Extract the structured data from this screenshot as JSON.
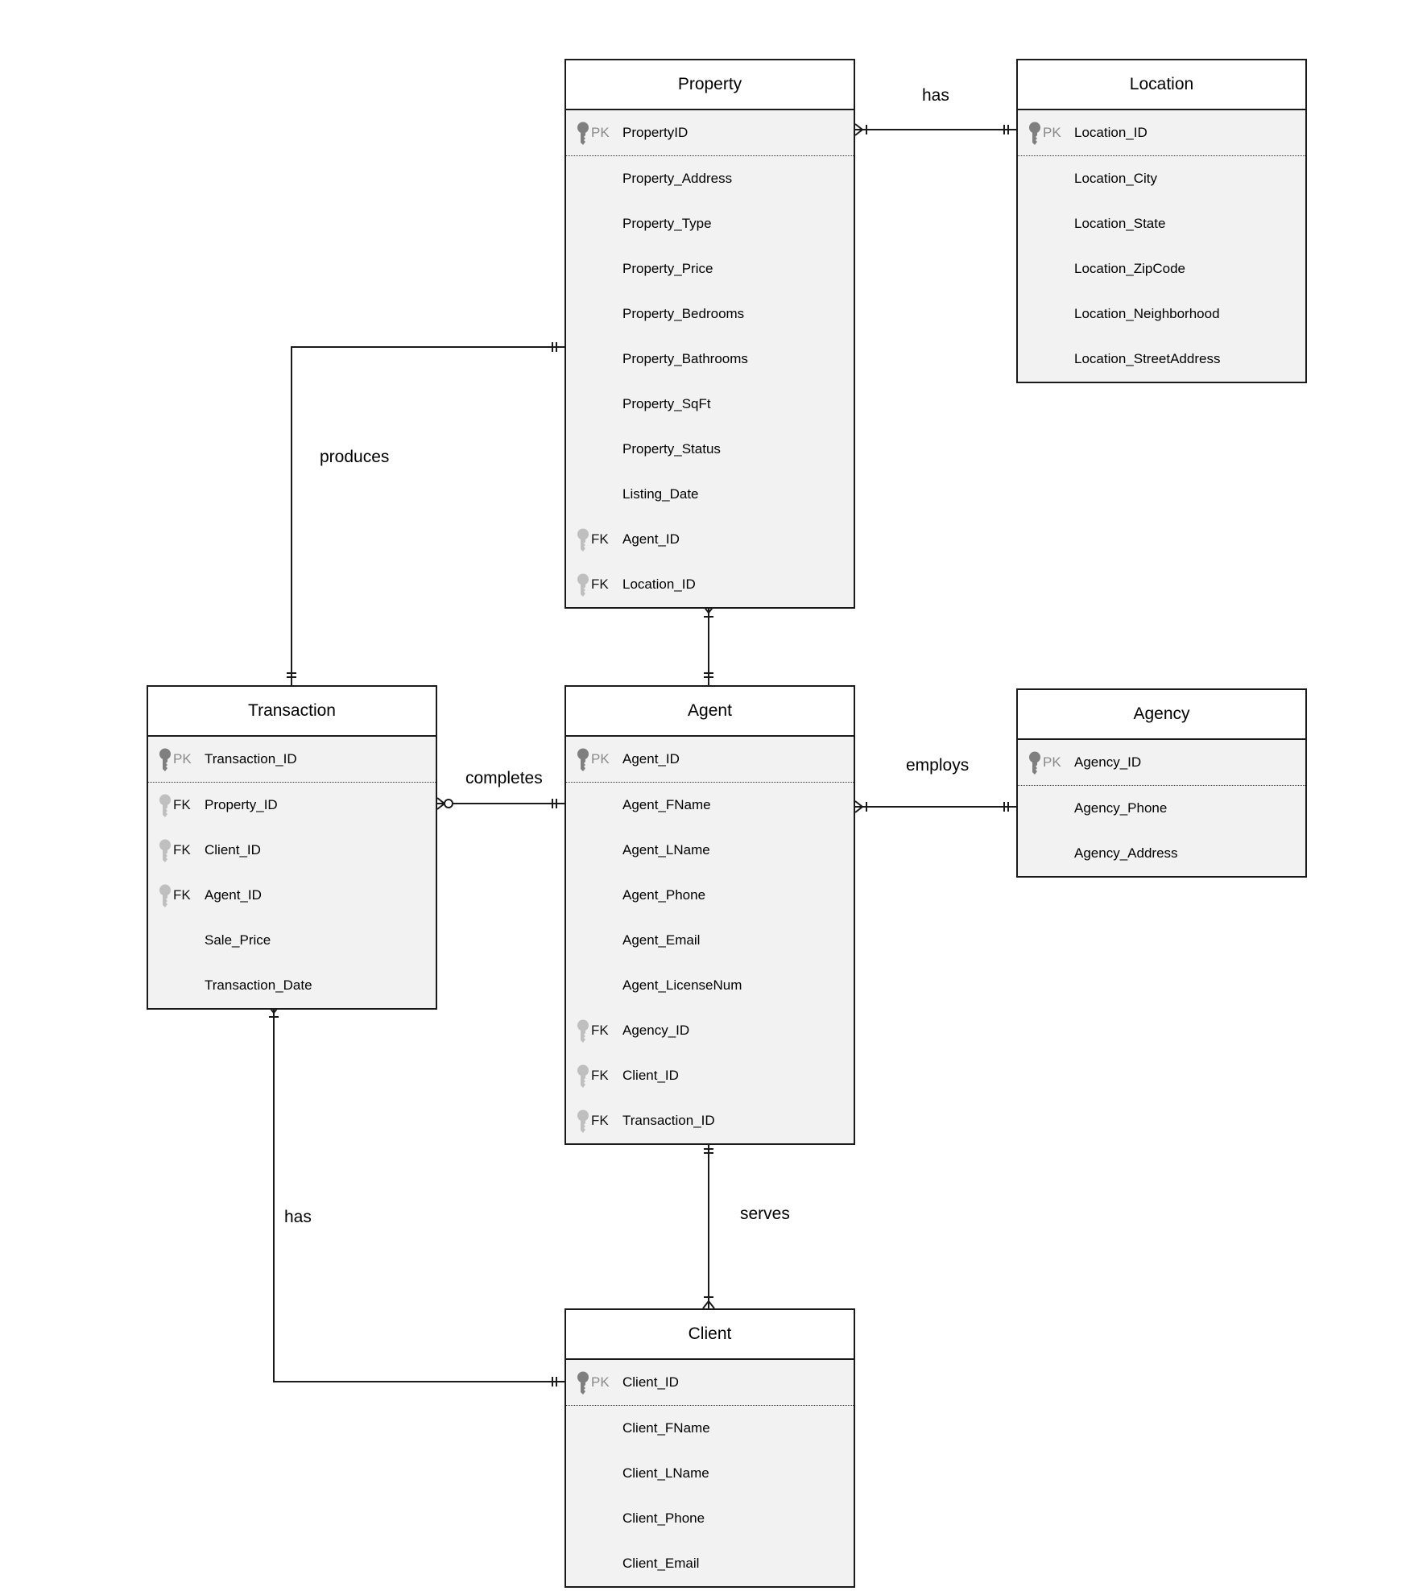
{
  "diagram": {
    "type": "entity-relationship",
    "notation": "crows-foot"
  },
  "entities": {
    "property": {
      "title": "Property",
      "fields": [
        {
          "key": "PK",
          "name": "PropertyID"
        },
        {
          "key": "",
          "name": "Property_Address"
        },
        {
          "key": "",
          "name": "Property_Type"
        },
        {
          "key": "",
          "name": "Property_Price"
        },
        {
          "key": "",
          "name": "Property_Bedrooms"
        },
        {
          "key": "",
          "name": "Property_Bathrooms"
        },
        {
          "key": "",
          "name": "Property_SqFt"
        },
        {
          "key": "",
          "name": "Property_Status"
        },
        {
          "key": "",
          "name": "Listing_Date"
        },
        {
          "key": "FK",
          "name": "Agent_ID"
        },
        {
          "key": "FK",
          "name": "Location_ID"
        }
      ]
    },
    "location": {
      "title": "Location",
      "fields": [
        {
          "key": "PK",
          "name": "Location_ID"
        },
        {
          "key": "",
          "name": "Location_City"
        },
        {
          "key": "",
          "name": "Location_State"
        },
        {
          "key": "",
          "name": "Location_ZipCode"
        },
        {
          "key": "",
          "name": "Location_Neighborhood"
        },
        {
          "key": "",
          "name": "Location_StreetAddress"
        }
      ]
    },
    "transaction": {
      "title": "Transaction",
      "fields": [
        {
          "key": "PK",
          "name": "Transaction_ID"
        },
        {
          "key": "FK",
          "name": "Property_ID"
        },
        {
          "key": "FK",
          "name": "Client_ID"
        },
        {
          "key": "FK",
          "name": "Agent_ID"
        },
        {
          "key": "",
          "name": "Sale_Price"
        },
        {
          "key": "",
          "name": "Transaction_Date"
        }
      ]
    },
    "agent": {
      "title": "Agent",
      "fields": [
        {
          "key": "PK",
          "name": "Agent_ID"
        },
        {
          "key": "",
          "name": "Agent_FName"
        },
        {
          "key": "",
          "name": "Agent_LName"
        },
        {
          "key": "",
          "name": "Agent_Phone"
        },
        {
          "key": "",
          "name": "Agent_Email"
        },
        {
          "key": "",
          "name": "Agent_LicenseNum"
        },
        {
          "key": "FK",
          "name": "Agency_ID"
        },
        {
          "key": "FK",
          "name": "Client_ID"
        },
        {
          "key": "FK",
          "name": "Transaction_ID"
        }
      ]
    },
    "agency": {
      "title": "Agency",
      "fields": [
        {
          "key": "PK",
          "name": "Agency_ID"
        },
        {
          "key": "",
          "name": "Agency_Phone"
        },
        {
          "key": "",
          "name": "Agency_Address"
        }
      ]
    },
    "client": {
      "title": "Client",
      "fields": [
        {
          "key": "PK",
          "name": "Client_ID"
        },
        {
          "key": "",
          "name": "Client_FName"
        },
        {
          "key": "",
          "name": "Client_LName"
        },
        {
          "key": "",
          "name": "Client_Phone"
        },
        {
          "key": "",
          "name": "Client_Email"
        }
      ]
    }
  },
  "relationships": [
    {
      "id": "property-location",
      "label": "has",
      "from": "Property",
      "from_cardinality": "one-or-many",
      "to": "Location",
      "to_cardinality": "one-and-only-one"
    },
    {
      "id": "property-transaction",
      "label": "produces",
      "from": "Property",
      "from_cardinality": "one-and-only-one",
      "to": "Transaction",
      "to_cardinality": "one-and-only-one"
    },
    {
      "id": "property-agent",
      "label": "",
      "from": "Property",
      "from_cardinality": "one-or-many",
      "to": "Agent",
      "to_cardinality": "one-and-only-one"
    },
    {
      "id": "transaction-agent",
      "label": "completes",
      "from": "Transaction",
      "from_cardinality": "zero-or-many",
      "to": "Agent",
      "to_cardinality": "one-and-only-one"
    },
    {
      "id": "agent-agency",
      "label": "employs",
      "from": "Agent",
      "from_cardinality": "one-or-many",
      "to": "Agency",
      "to_cardinality": "one-and-only-one"
    },
    {
      "id": "agent-client",
      "label": "serves",
      "from": "Agent",
      "from_cardinality": "one-and-only-one",
      "to": "Client",
      "to_cardinality": "one-or-many"
    },
    {
      "id": "transaction-client",
      "label": "has",
      "from": "Transaction",
      "from_cardinality": "one-or-many",
      "to": "Client",
      "to_cardinality": "one-and-only-one"
    }
  ],
  "colors": {
    "pk_key": "#7f7f7f",
    "fk_key": "#bfbfbf",
    "pk_text": "#8a8a8a",
    "body_fill": "#f2f2f2",
    "header_fill": "#ffffff",
    "line": "#1a1a1a"
  }
}
